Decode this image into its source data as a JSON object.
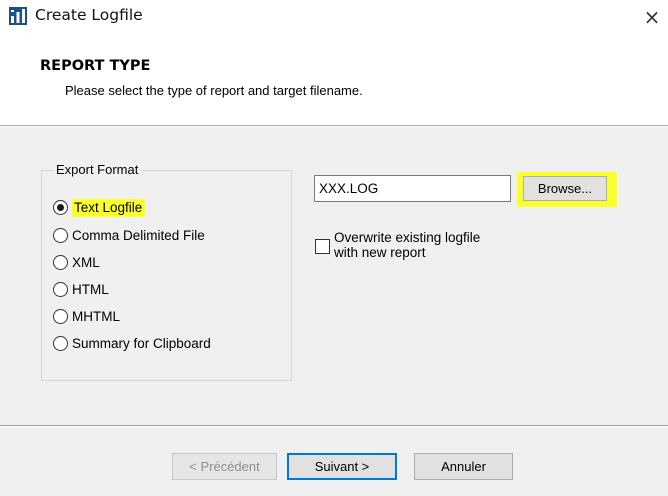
{
  "window": {
    "title": "Create Logfile",
    "close_glyph": "×",
    "icon": "app-icon"
  },
  "header": {
    "title": "REPORT TYPE",
    "subtitle": "Please select the type of report and target filename."
  },
  "export_format": {
    "legend": "Export Format",
    "options": [
      {
        "label": "Text Logfile",
        "selected": true,
        "highlighted": true
      },
      {
        "label": "Comma Delimited File",
        "selected": false
      },
      {
        "label": "XML",
        "selected": false
      },
      {
        "label": "HTML",
        "selected": false
      },
      {
        "label": "MHTML",
        "selected": false
      },
      {
        "label": "Summary for Clipboard",
        "selected": false
      }
    ]
  },
  "target": {
    "filename_value": "XXX.LOG",
    "browse_label": "Browse...",
    "overwrite_label_line1": "Overwrite existing logfile",
    "overwrite_label_line2": "with new report",
    "overwrite_checked": false
  },
  "footer": {
    "back_label": "< Précédent",
    "next_label": "Suivant >",
    "cancel_label": "Annuler"
  },
  "colors": {
    "highlight": "#fbff2a",
    "default_button_border": "#0078d7",
    "dialog_background": "#f0f0f0"
  }
}
